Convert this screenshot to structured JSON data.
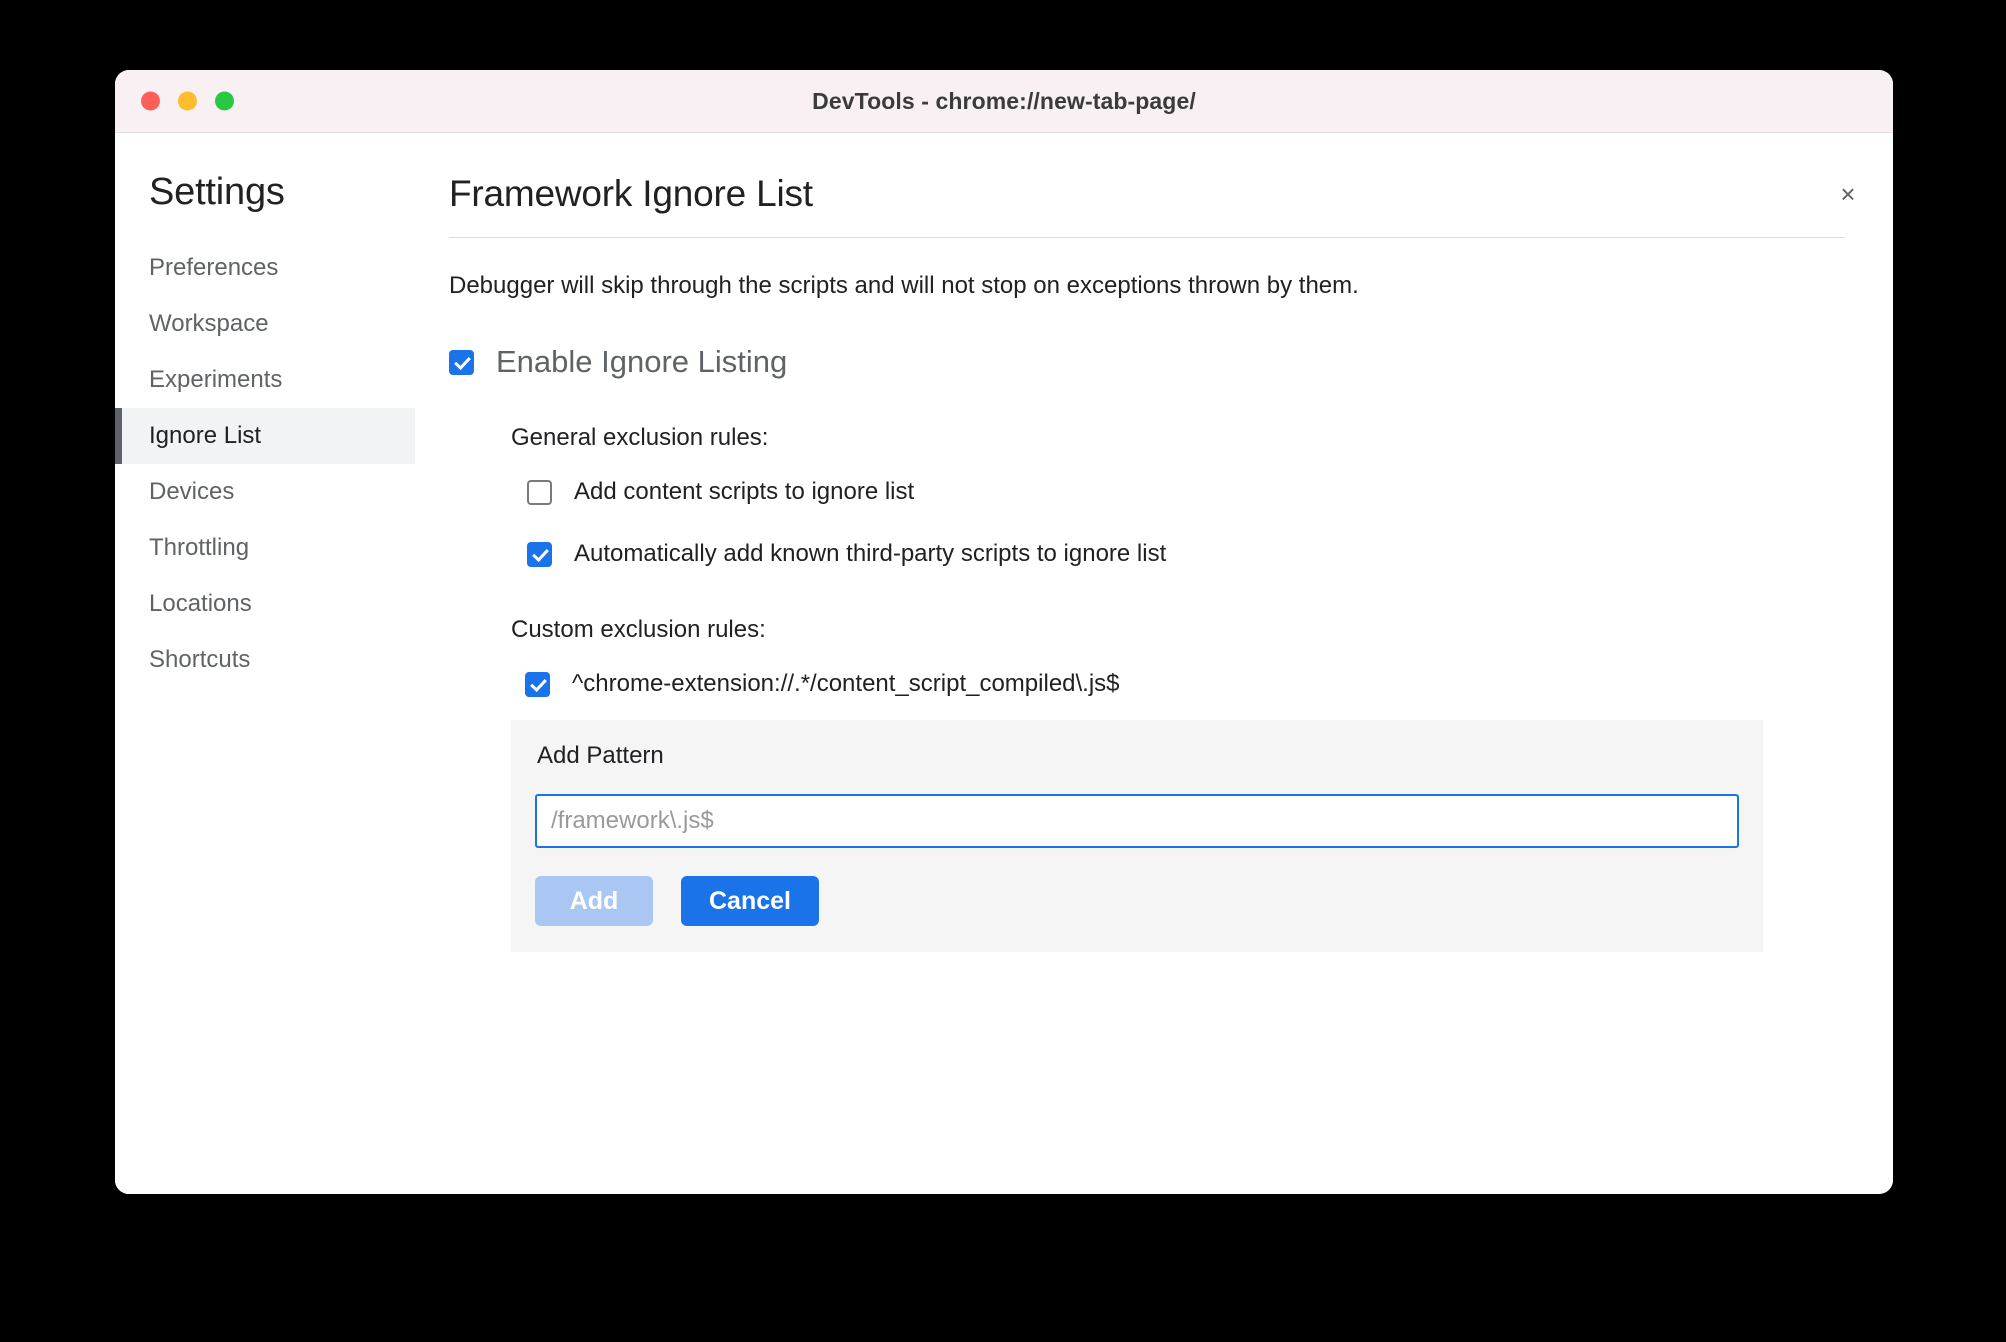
{
  "window": {
    "title": "DevTools - chrome://new-tab-page/",
    "close_label": "×",
    "traffic_lights": [
      "close-red",
      "minimize-yellow",
      "zoom-green"
    ]
  },
  "sidebar": {
    "heading": "Settings",
    "items": [
      {
        "label": "Preferences",
        "selected": false
      },
      {
        "label": "Workspace",
        "selected": false
      },
      {
        "label": "Experiments",
        "selected": false
      },
      {
        "label": "Ignore List",
        "selected": true
      },
      {
        "label": "Devices",
        "selected": false
      },
      {
        "label": "Throttling",
        "selected": false
      },
      {
        "label": "Locations",
        "selected": false
      },
      {
        "label": "Shortcuts",
        "selected": false
      }
    ]
  },
  "main": {
    "title": "Framework Ignore List",
    "description": "Debugger will skip through the scripts and will not stop on exceptions thrown by them.",
    "enable_toggle": {
      "label": "Enable Ignore Listing",
      "checked": true
    },
    "general_rules": {
      "label": "General exclusion rules:",
      "items": [
        {
          "label": "Add content scripts to ignore list",
          "checked": false
        },
        {
          "label": "Automatically add known third-party scripts to ignore list",
          "checked": true
        }
      ]
    },
    "custom_rules": {
      "label": "Custom exclusion rules:",
      "items": [
        {
          "label": "^chrome-extension://.*/content_script_compiled\\.js$",
          "checked": true
        }
      ]
    },
    "add_pattern": {
      "title": "Add Pattern",
      "input_placeholder": "/framework\\.js$",
      "input_value": "",
      "add_label": "Add",
      "add_disabled": true,
      "cancel_label": "Cancel"
    }
  },
  "colors": {
    "accent_blue": "#1a73e8",
    "accent_blue_disabled": "#aac7f4",
    "titlebar_bg": "#f9f0f3",
    "selected_nav_bg": "#f1f3f4",
    "panel_bg": "#f5f5f5",
    "text_primary": "#202124",
    "text_secondary": "#5f6368"
  }
}
